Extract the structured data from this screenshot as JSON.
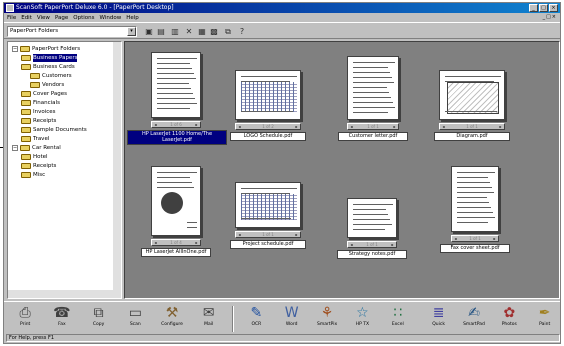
{
  "window": {
    "title": "ScanSoft PaperPort Deluxe 6.0 - [PaperPort Desktop]"
  },
  "menu": [
    "File",
    "Edit",
    "View",
    "Page",
    "Options",
    "Window",
    "Help"
  ],
  "folder_combo": {
    "value": "PaperPort Folders"
  },
  "tree": [
    {
      "label": "PaperPort Folders",
      "depth": 0
    },
    {
      "label": "Business Papers",
      "depth": 1,
      "selected": true
    },
    {
      "label": "Business Cards",
      "depth": 1
    },
    {
      "label": "Customers",
      "depth": 2
    },
    {
      "label": "Vendors",
      "depth": 2
    },
    {
      "label": "Cover Pages",
      "depth": 1
    },
    {
      "label": "Financials",
      "depth": 1
    },
    {
      "label": "Invoices",
      "depth": 1
    },
    {
      "label": "Receipts",
      "depth": 1
    },
    {
      "label": "Sample Documents",
      "depth": 1
    },
    {
      "label": "Travel",
      "depth": 1
    },
    {
      "label": "Car Rental",
      "depth": 0
    },
    {
      "label": "Hotel",
      "depth": 1
    },
    {
      "label": "Receipts",
      "depth": 1
    },
    {
      "label": "Misc",
      "depth": 1
    }
  ],
  "items": [
    {
      "caption": "HP LaserJet 1100 Home/The LaserJet.pdf",
      "selected": true,
      "page": "1 of 6"
    },
    {
      "caption": "LOGO Schedule.pdf",
      "selected": false,
      "page": "1 of 2"
    },
    {
      "caption": "Customer letter.pdf",
      "selected": false,
      "page": "1 of 1"
    },
    {
      "caption": "Diagram.pdf",
      "selected": false,
      "page": "1 of 1"
    },
    {
      "caption": "HP LaserJet AllInOne.pdf",
      "selected": false,
      "page": "1 of 4"
    },
    {
      "caption": "Project schedule.pdf",
      "selected": false,
      "page": "1 of 1"
    },
    {
      "caption": "Strategy notes.pdf",
      "selected": false,
      "page": "1 of 1"
    },
    {
      "caption": "Fax cover sheet.pdf",
      "selected": false,
      "page": "1 of 1"
    }
  ],
  "bottom_buttons": [
    {
      "label": "Print",
      "icon": "printer-icon",
      "glyph": "⎙"
    },
    {
      "label": "Fax",
      "icon": "fax-icon",
      "glyph": "☎"
    },
    {
      "label": "Copy",
      "icon": "copy-icon",
      "glyph": "⧉"
    },
    {
      "label": "Scan",
      "icon": "scan-icon",
      "glyph": "▭"
    },
    {
      "label": "Configure",
      "icon": "configure-icon",
      "glyph": "⚒"
    },
    {
      "label": "Mail",
      "icon": "mail-icon",
      "glyph": "✉"
    },
    {
      "label": "OCR",
      "icon": "ocr-icon",
      "glyph": "✎"
    },
    {
      "label": "Word",
      "icon": "word-icon",
      "glyph": "W"
    },
    {
      "label": "SmartPix",
      "icon": "smartpix-icon",
      "glyph": "⚘"
    },
    {
      "label": "HP TX",
      "icon": "hp-tx-icon",
      "glyph": "☆"
    },
    {
      "label": "Excel",
      "icon": "excel-icon",
      "glyph": "∷"
    },
    {
      "label": "Quick",
      "icon": "quick-icon",
      "glyph": "≣"
    },
    {
      "label": "SmartPad",
      "icon": "smartpad-icon",
      "glyph": "✍"
    },
    {
      "label": "Photos",
      "icon": "photos-icon",
      "glyph": "✿"
    },
    {
      "label": "Paint",
      "icon": "paint-icon",
      "glyph": "✒"
    }
  ],
  "status": "For Help, press F1"
}
